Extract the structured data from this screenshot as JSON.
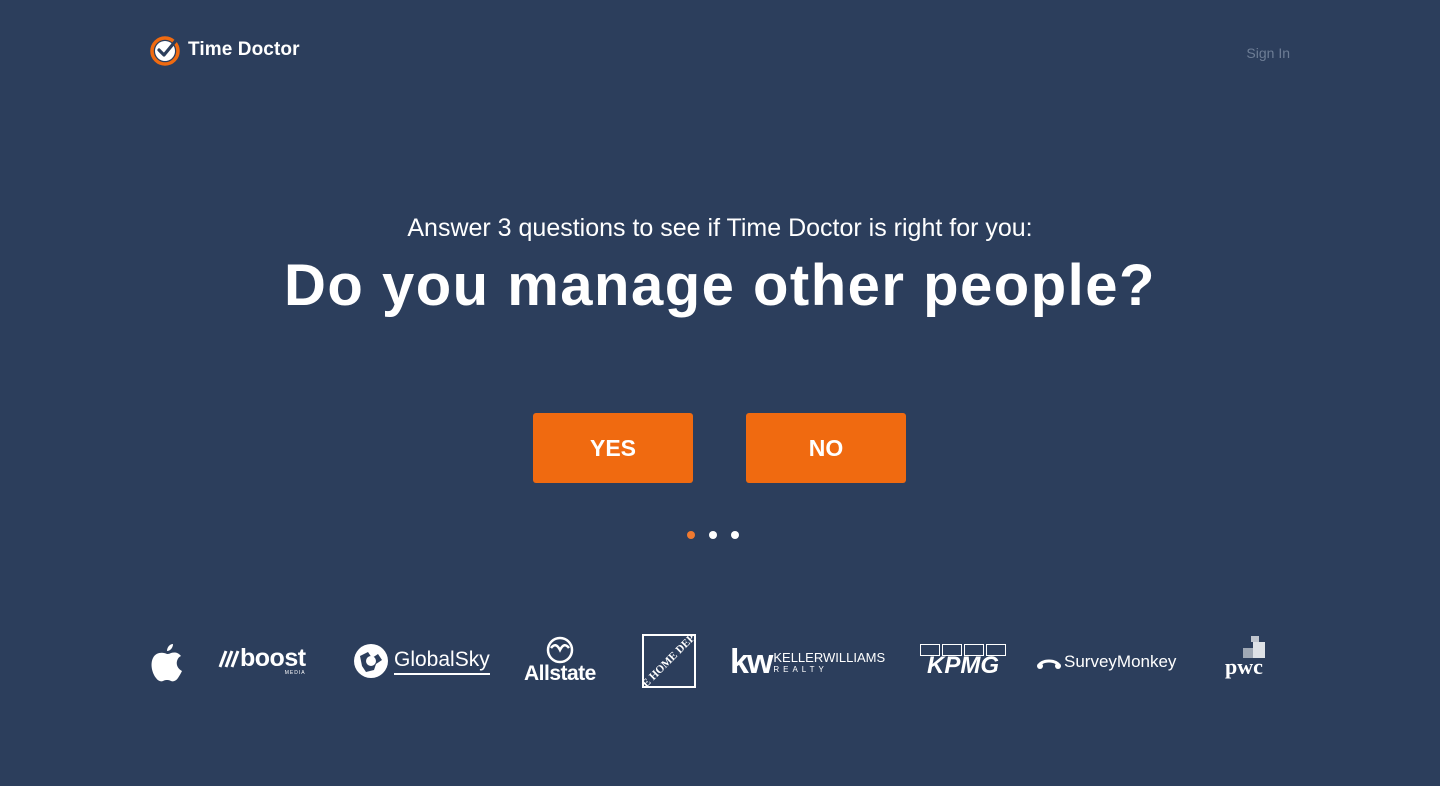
{
  "header": {
    "logo_text": "Time Doctor",
    "sign_in": "Sign In"
  },
  "hero": {
    "subtitle": "Answer 3 questions to see if Time Doctor is right for you:",
    "question": "Do you manage other people?"
  },
  "answers": {
    "yes": "YES",
    "no": "NO"
  },
  "progress": {
    "total_steps": 3,
    "current_step": 1
  },
  "brands": {
    "boost": "boost",
    "boost_sub": "MEDIA",
    "globalsky": "GlobalSky",
    "allstate": "Allstate",
    "homedepot": "THE HOME DEPOT",
    "kw_mark": "kw",
    "kw_name": "KELLERWILLIAMS",
    "kw_sub": "REALTY",
    "kpmg": "KPMG",
    "surveymonkey": "SurveyMonkey",
    "pwc": "pwc"
  },
  "colors": {
    "background": "#2c3e5c",
    "accent": "#f06a10",
    "sign_in": "#6d7d95"
  }
}
